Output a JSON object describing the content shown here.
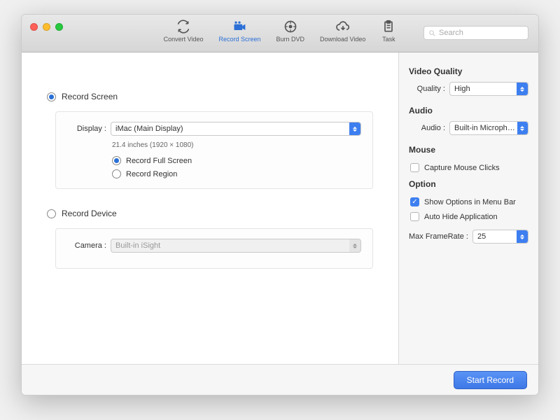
{
  "toolbar": {
    "convert": "Convert Video",
    "record": "Record Screen",
    "burn": "Burn DVD",
    "download": "Download Video",
    "task": "Task"
  },
  "search": {
    "placeholder": "Search"
  },
  "main": {
    "record_screen_label": "Record Screen",
    "display_label": "Display :",
    "display_value": "iMac (Main Display)",
    "display_hint": "21.4 inches (1920 × 1080)",
    "record_full": "Record Full Screen",
    "record_region": "Record Region",
    "record_device_label": "Record Device",
    "camera_label": "Camera :",
    "camera_value": "Built-in iSight"
  },
  "side": {
    "video_quality_h": "Video Quality",
    "quality_label": "Quality :",
    "quality_value": "High",
    "audio_h": "Audio",
    "audio_label": "Audio :",
    "audio_value": "Built-in Microphone",
    "mouse_h": "Mouse",
    "capture_clicks": "Capture Mouse Clicks",
    "option_h": "Option",
    "show_menu": "Show Options in Menu Bar",
    "auto_hide": "Auto Hide Application",
    "max_fr_label": "Max FrameRate :",
    "max_fr_value": "25"
  },
  "footer": {
    "start": "Start Record"
  }
}
